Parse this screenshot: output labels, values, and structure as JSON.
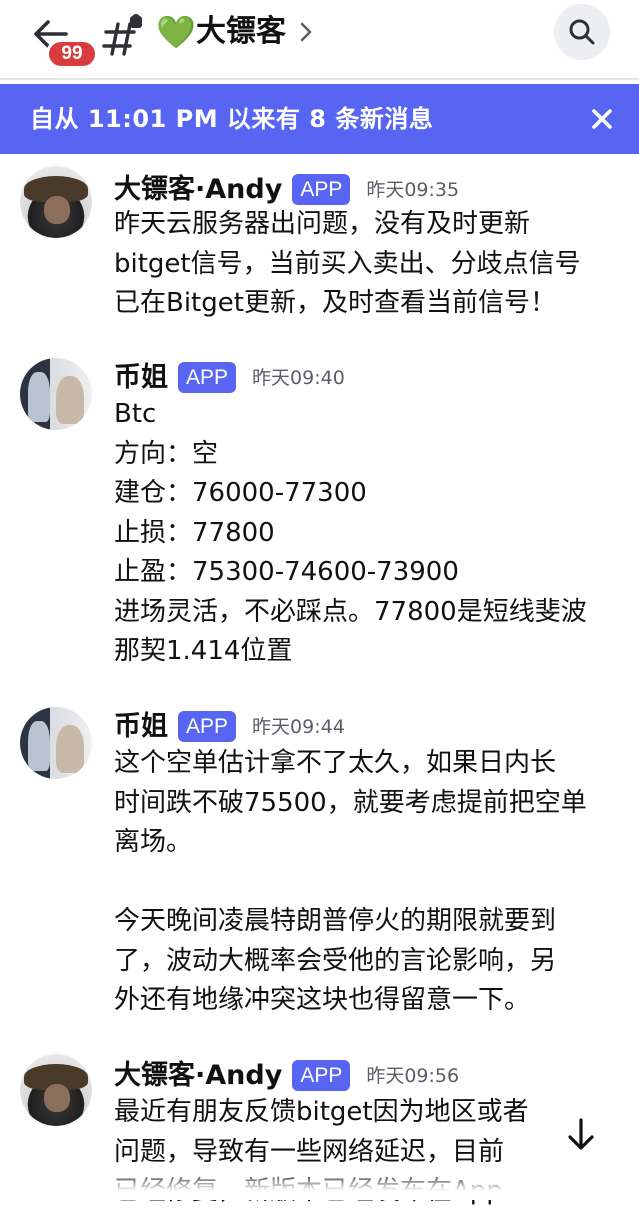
{
  "header": {
    "unread_badge": "99",
    "channel_emoji": "💚",
    "channel_name": "大镖客",
    "icons": [
      "back-arrow-icon",
      "hashtag-channel-icon",
      "chevron-right-icon",
      "search-icon"
    ]
  },
  "new_messages_bar": {
    "text": "自从 11:01 PM 以来有 8 条新消息",
    "close_icon": "close-icon",
    "color": "#5865f2"
  },
  "messages": [
    {
      "author": "大镖客·Andy",
      "tag": "APP",
      "time": "昨天09:35",
      "lines": [
        "昨天云服务器出问题，没有及时更新",
        "bitget信号，当前买入卖出、分歧点信号",
        "已在Bitget更新，及时查看当前信号！"
      ]
    },
    {
      "author": "币姐",
      "tag": "APP",
      "time": "昨天09:40",
      "lines": [
        "Btc",
        "方向：空",
        "建仓：76000-77300",
        "止损：77800",
        "止盈：75300-74600-73900",
        "进场灵活，不必踩点。77800是短线斐波",
        "那契1.414位置"
      ]
    },
    {
      "author": "币姐",
      "tag": "APP",
      "time": "昨天09:44",
      "lines": [
        "这个空单估计拿不了太久，如果日内长",
        "时间跌不破75500，就要考虑提前把空单",
        "离场。",
        "",
        "今天晚间凌晨特朗普停火的期限就要到",
        "了，波动大概率会受他的言论影响，另",
        "外还有地缘冲突这块也得留意一下。"
      ]
    },
    {
      "author": "大镖客·Andy",
      "tag": "APP",
      "time": "昨天09:56",
      "lines": [
        "最近有朋友反馈bitget因为地区或者",
        "问题，导致有一些网络延迟，目前",
        "已经修复，新版本已经发布在App"
      ]
    }
  ],
  "scroll_button_icon": "arrow-down-icon",
  "colors": {
    "accent": "#5865f2",
    "badge": "#d83c3e",
    "timestamp": "#5c5e66"
  }
}
